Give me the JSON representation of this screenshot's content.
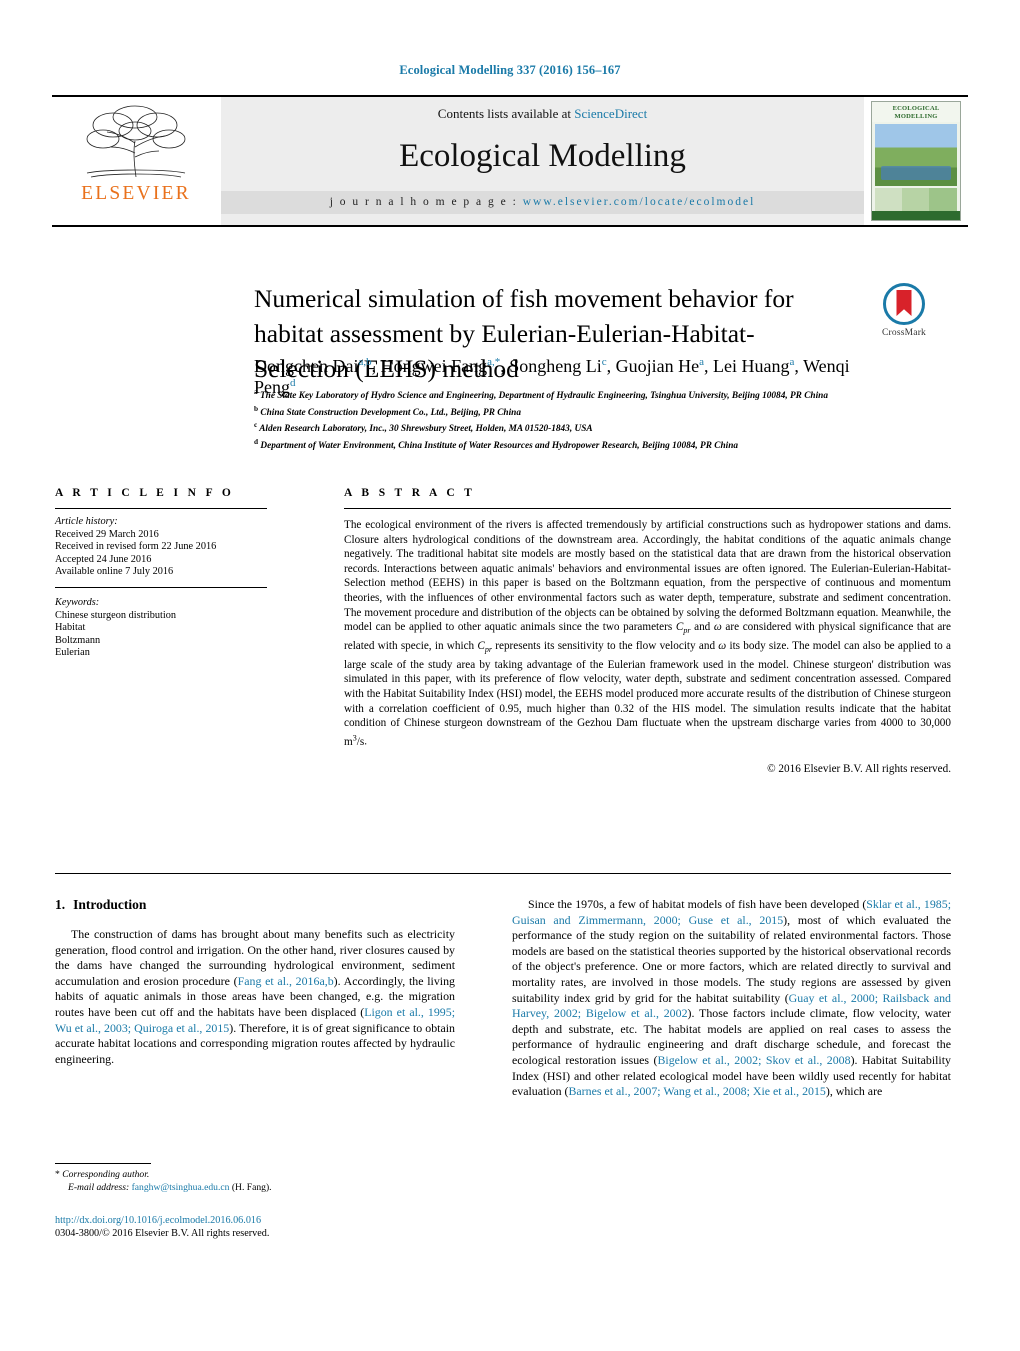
{
  "running_head": "Ecological Modelling 337 (2016) 156–167",
  "masthead": {
    "publisher": "ELSEVIER",
    "contents_prefix": "Contents lists available at ",
    "contents_link": "ScienceDirect",
    "journal_name": "Ecological Modelling",
    "homepage_prefix": "j o u r n a l   h o m e p a g e :",
    "homepage_url": "www.elsevier.com/locate/ecolmodel",
    "cover_title_line1": "ECOLOGICAL",
    "cover_title_line2": "MODELLING"
  },
  "crossmark": {
    "label": "CrossMark"
  },
  "article": {
    "title": "Numerical simulation of fish movement behavior for habitat assessment by Eulerian-Eulerian-Habitat-Selection (EEHS) method",
    "authors": [
      {
        "name": "Dongchen Dai",
        "sup": "a,b"
      },
      {
        "name": "Hongwei Fang",
        "sup": "a,*"
      },
      {
        "name": "Songheng Li",
        "sup": "c"
      },
      {
        "name": "Guojian He",
        "sup": "a"
      },
      {
        "name": "Lei Huang",
        "sup": "a"
      },
      {
        "name": "Wenqi Peng",
        "sup": "d"
      }
    ],
    "affiliations": [
      {
        "label": "a",
        "text": "The State Key Laboratory of Hydro Science and Engineering, Department of Hydraulic Engineering, Tsinghua University, Beijing 10084, PR China"
      },
      {
        "label": "b",
        "text": "China State Construction Development Co., Ltd., Beijing, PR China"
      },
      {
        "label": "c",
        "text": "Alden Research Laboratory, Inc., 30 Shrewsbury Street, Holden, MA 01520-1843, USA"
      },
      {
        "label": "d",
        "text": "Department of Water Environment, China Institute of Water Resources and Hydropower Research, Beijing 10084, PR China"
      }
    ]
  },
  "article_info": {
    "heading": "A R T I C L E   I N F O",
    "history_label": "Article history:",
    "history": [
      "Received 29 March 2016",
      "Received in revised form 22 June 2016",
      "Accepted 24 June 2016",
      "Available online 7 July 2016"
    ],
    "keywords_label": "Keywords:",
    "keywords": [
      "Chinese sturgeon distribution",
      "Habitat",
      "Boltzmann",
      "Eulerian"
    ]
  },
  "abstract": {
    "heading": "A B S T R A C T",
    "text": "The ecological environment of the rivers is affected tremendously by artificial constructions such as hydropower stations and dams. Closure alters hydrological conditions of the downstream area. Accordingly, the habitat conditions of the aquatic animals change negatively. The traditional habitat site models are mostly based on the statistical data that are drawn from the historical observation records. Interactions between aquatic animals' behaviors and environmental issues are often ignored. The Eulerian-Eulerian-Habitat-Selection method (EEHS) in this paper is based on the Boltzmann equation, from the perspective of continuous and momentum theories, with the influences of other environmental factors such as water depth, temperature, substrate and sediment concentration. The movement procedure and distribution of the objects can be obtained by solving the deformed Boltzmann equation. Meanwhile, the model can be applied to other aquatic animals since the two parameters Cpr and ω are considered with physical significance that are related with specie, in which Cpr represents its sensitivity to the flow velocity and ω its body size. The model can also be applied to a large scale of the study area by taking advantage of the Eulerian framework used in the model. Chinese sturgeon' distribution was simulated in this paper, with its preference of flow velocity, water depth, substrate and sediment concentration assessed. Compared with the Habitat Suitability Index (HSI) model, the EEHS model produced more accurate results of the distribution of Chinese sturgeon with a correlation coefficient of 0.95, much higher than 0.32 of the HIS model. The simulation results indicate that the habitat condition of Chinese sturgeon downstream of the Gezhou Dam fluctuate when the upstream discharge varies from 4000 to 30,000 m3/s.",
    "copyright": "© 2016 Elsevier B.V. All rights reserved."
  },
  "introduction": {
    "number": "1.",
    "title": "Introduction",
    "left_paragraph_parts": [
      {
        "t": "The construction of dams has brought about many benefits such as electricity generation, flood control and irrigation. On the other hand, river closures caused by the dams have changed the surrounding hydrological environment, sediment accumulation and erosion procedure (",
        "k": "plain"
      },
      {
        "t": "Fang et al., 2016a,b",
        "k": "ref"
      },
      {
        "t": "). Accordingly, the living habits of aquatic animals in those areas have been changed, e.g. the migration routes have been cut off and the habitats have been displaced (",
        "k": "plain"
      },
      {
        "t": "Ligon et al., 1995; Wu et al., 2003; Quiroga et al., 2015",
        "k": "ref"
      },
      {
        "t": "). Therefore, it is of great significance to obtain accurate habitat locations and corresponding migration routes affected by hydraulic engineering.",
        "k": "plain"
      }
    ],
    "right_paragraph_parts": [
      {
        "t": "Since the 1970s, a few of habitat models of fish have been developed (",
        "k": "plain"
      },
      {
        "t": "Sklar et al., 1985; Guisan and Zimmermann, 2000; Guse et al., 2015",
        "k": "ref"
      },
      {
        "t": "), most of which evaluated the performance of the study region on the suitability of related environmental factors. Those models are based on the statistical theories supported by the historical observational records of the object's preference. One or more factors, which are related directly to survival and mortality rates, are involved in those models. The study regions are assessed by given suitability index grid by grid for the habitat suitability (",
        "k": "plain"
      },
      {
        "t": "Guay et al., 2000; Railsback and Harvey, 2002; Bigelow et al., 2002",
        "k": "ref"
      },
      {
        "t": "). Those factors include climate, flow velocity, water depth and substrate, etc. The habitat models are applied on real cases to assess the performance of hydraulic engineering and draft discharge schedule, and forecast the ecological restoration issues (",
        "k": "plain"
      },
      {
        "t": "Bigelow et al., 2002; Skov et al., 2008",
        "k": "ref"
      },
      {
        "t": "). Habitat Suitability Index (HSI) and other related ecological model have been wildly used recently for habitat evaluation (",
        "k": "plain"
      },
      {
        "t": "Barnes et al., 2007; Wang et al., 2008; Xie et al., 2015",
        "k": "ref"
      },
      {
        "t": "), which are",
        "k": "plain"
      }
    ]
  },
  "footnote": {
    "star": "*",
    "corresponding": "Corresponding author.",
    "email_label": "E-mail address:",
    "email": "fanghw@tsinghua.edu.cn",
    "email_owner": "(H. Fang)."
  },
  "footer": {
    "doi": "http://dx.doi.org/10.1016/j.ecolmodel.2016.06.016",
    "issn": "0304-3800/© 2016 Elsevier B.V. All rights reserved."
  },
  "colors": {
    "link": "#1a7aa8",
    "elsevier_orange": "#E9711C",
    "crossmark_red": "#d8222a"
  }
}
